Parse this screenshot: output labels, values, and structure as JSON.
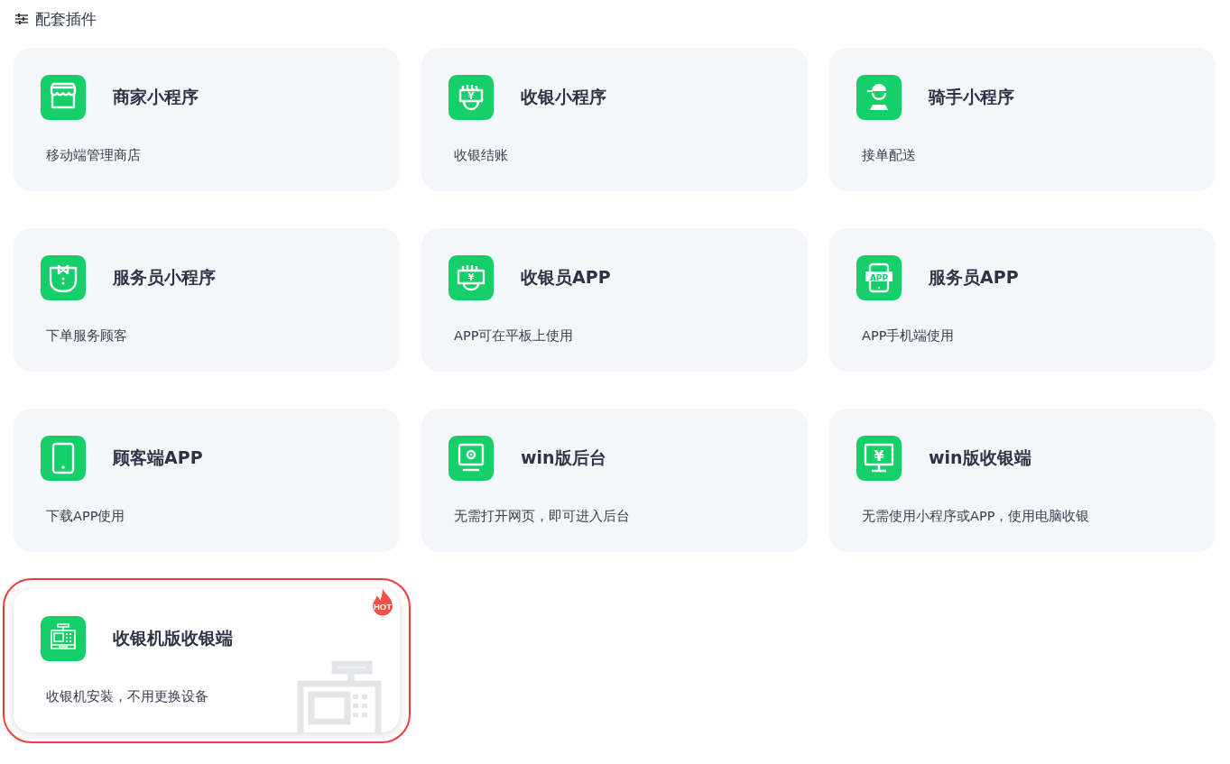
{
  "section_title": "配套插件",
  "plugins": [
    {
      "kind": "store",
      "title": "商家小程序",
      "description": "移动端管理商店",
      "selected": false,
      "hot": false
    },
    {
      "kind": "cashier",
      "title": "收银小程序",
      "description": "收银结账",
      "selected": false,
      "hot": false,
      "icon_text": "¥"
    },
    {
      "kind": "rider",
      "title": "骑手小程序",
      "description": "接单配送",
      "selected": false,
      "hot": false
    },
    {
      "kind": "waiter",
      "title": "服务员小程序",
      "description": "下单服务顾客",
      "selected": false,
      "hot": false
    },
    {
      "kind": "cashier-app",
      "title": "收银员APP",
      "description": "APP可在平板上使用",
      "selected": false,
      "hot": false,
      "icon_text": "¥"
    },
    {
      "kind": "phone-app",
      "title": "服务员APP",
      "description": "APP手机端使用",
      "selected": false,
      "hot": false,
      "icon_text": "APP"
    },
    {
      "kind": "tablet",
      "title": "顾客端APP",
      "description": "下载APP使用",
      "selected": false,
      "hot": false
    },
    {
      "kind": "monitor-gear",
      "title": "win版后台",
      "description": "无需打开网页，即可进入后台",
      "selected": false,
      "hot": false
    },
    {
      "kind": "monitor-yen",
      "title": "win版收银端",
      "description": "无需使用小程序或APP，使用电脑收银",
      "selected": false,
      "hot": false,
      "icon_text": "¥"
    },
    {
      "kind": "register",
      "title": "收银机版收银端",
      "description": "收银机安装，不用更换设备",
      "selected": true,
      "hot": true,
      "hot_label": "HOT"
    }
  ]
}
